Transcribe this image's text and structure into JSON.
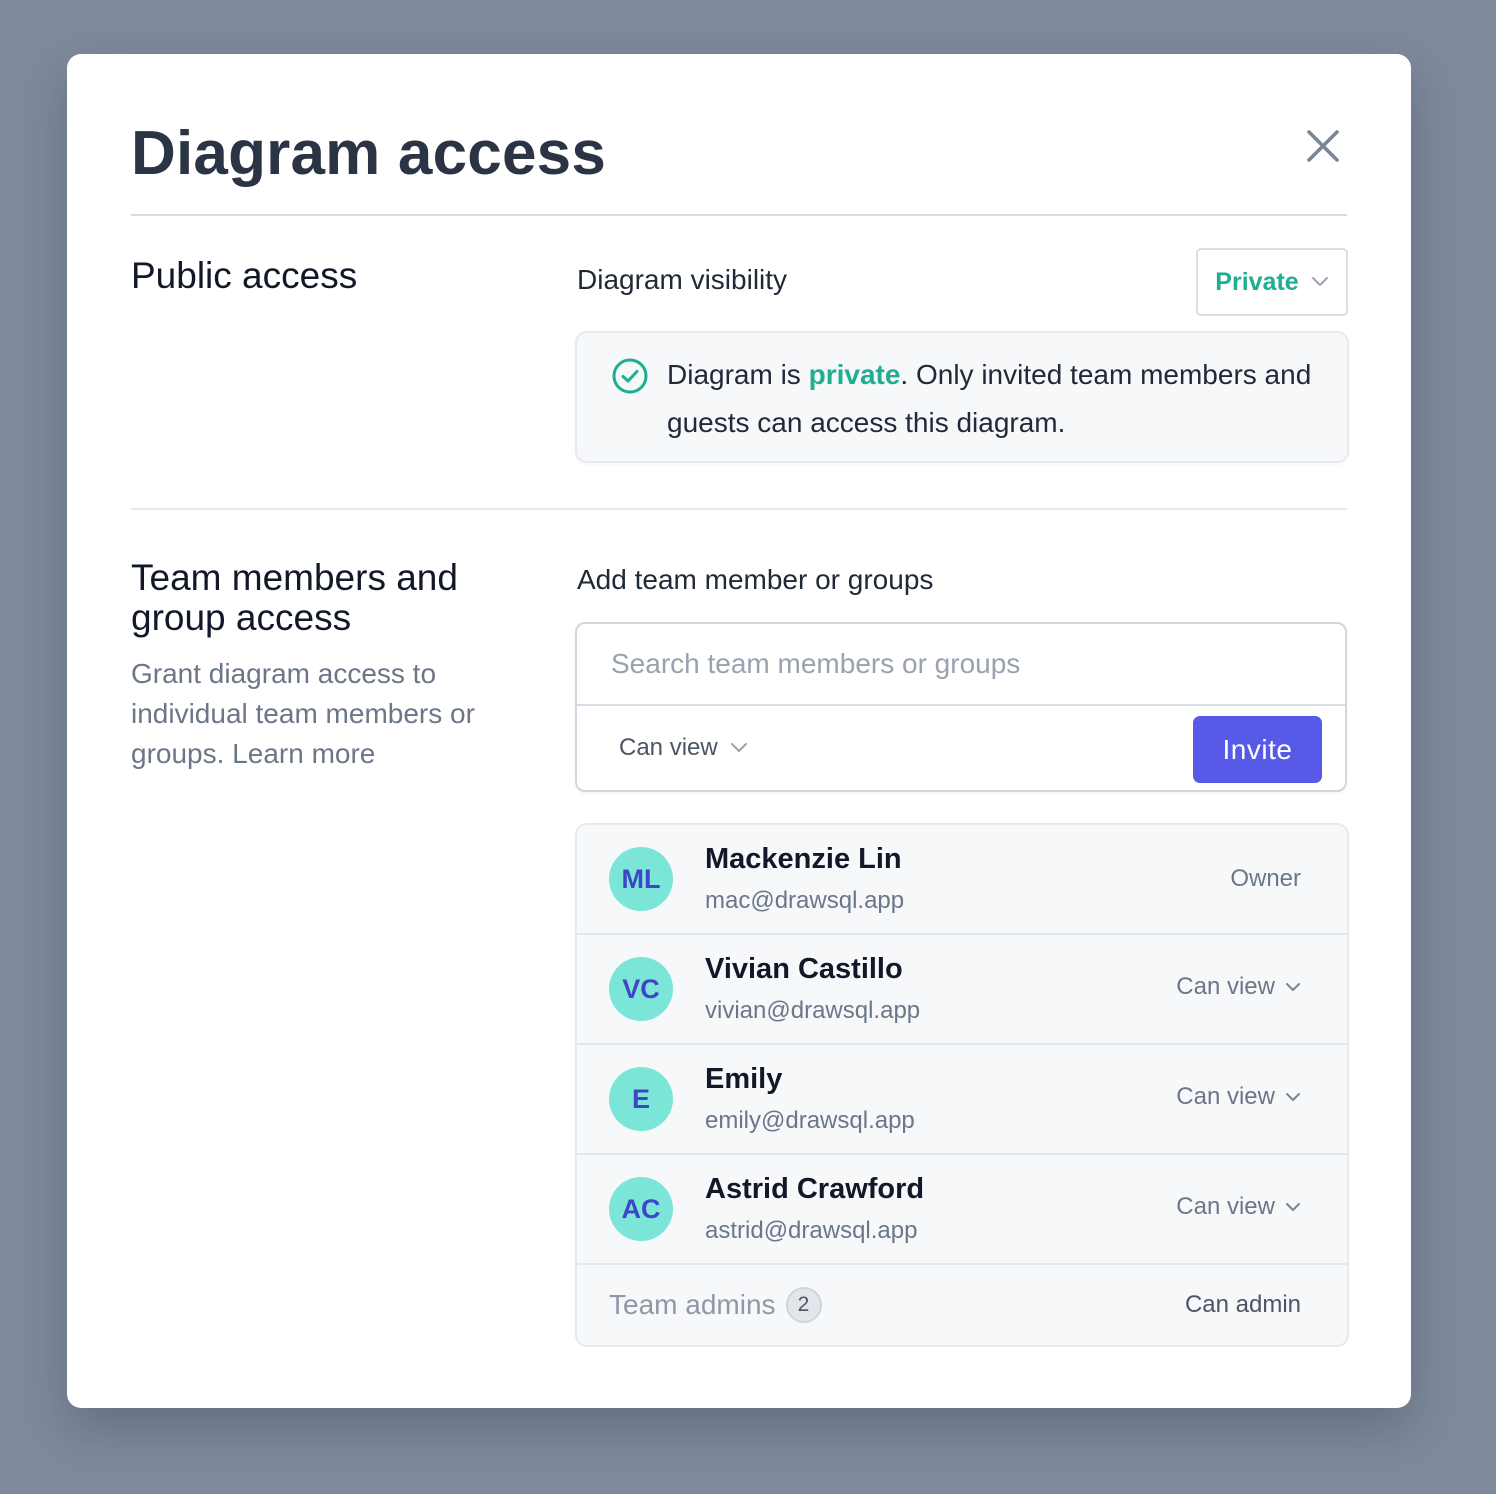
{
  "modal": {
    "title": "Diagram access"
  },
  "public_access": {
    "section_title": "Public access",
    "visibility_label": "Diagram visibility",
    "visibility_value": "Private",
    "info": {
      "prefix": "Diagram is ",
      "emphasis": "private",
      "suffix": ". Only invited team members and guests can access this diagram."
    }
  },
  "team_access": {
    "section_title": "Team members and group access",
    "description": "Grant diagram access to individual team members or groups. Learn more",
    "add_label": "Add team member or groups",
    "search_placeholder": "Search team members or groups",
    "permission_value": "Can view",
    "invite_label": "Invite",
    "members": [
      {
        "initials": "ML",
        "name": "Mackenzie Lin",
        "email": "mac@drawsql.app",
        "role": "Owner"
      },
      {
        "initials": "VC",
        "name": "Vivian Castillo",
        "email": "vivian@drawsql.app",
        "permission": "Can view"
      },
      {
        "initials": "E",
        "name": "Emily",
        "email": "emily@drawsql.app",
        "permission": "Can view"
      },
      {
        "initials": "AC",
        "name": "Astrid Crawford",
        "email": "astrid@drawsql.app",
        "permission": "Can view"
      }
    ],
    "admins": {
      "label": "Team admins",
      "count": "2",
      "permission": "Can admin"
    }
  },
  "colors": {
    "accent_green": "#1fae92",
    "invite_button": "#575ae6",
    "avatar_bg": "#7be6d8",
    "avatar_text": "#3f45c7",
    "backdrop": "#7f8a9c"
  },
  "icons": {
    "close": "close-icon",
    "chevron": "chevron-down-icon",
    "check": "check-circle-icon"
  }
}
